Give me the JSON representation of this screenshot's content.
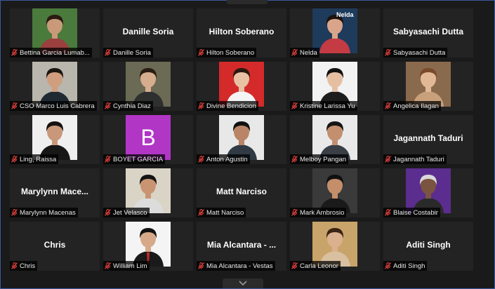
{
  "meeting": {
    "participants": [
      {
        "display": "Bettina Garcia Lumab...",
        "big_name": "",
        "has_video": true,
        "bg": "#4a7a3c",
        "skin": "#c99a7a",
        "hair": "#2a1a12",
        "shirt": "#9b3f3f"
      },
      {
        "display": "Danille Soria",
        "big_name": "Danille Soria",
        "has_video": false
      },
      {
        "display": "Hilton Soberano",
        "big_name": "Hilton Soberano",
        "has_video": false
      },
      {
        "display": "Nelda",
        "big_name": "",
        "has_video": true,
        "bg": "#1e3b5c",
        "skin": "#d9a58a",
        "hair": "#1c130d",
        "shirt": "#c43b44",
        "overlay_text": "Nelda"
      },
      {
        "display": "Sabyasachi Dutta",
        "big_name": "Sabyasachi Dutta",
        "has_video": false
      },
      {
        "display": "CSO Marco Luis Cabrera",
        "big_name": "",
        "has_video": true,
        "bg": "#b9b6ad",
        "skin": "#cf9e7e",
        "hair": "#1b1510",
        "shirt": "#1f2a33"
      },
      {
        "display": "Cynthia Diaz",
        "big_name": "",
        "has_video": true,
        "bg": "#6b6a55",
        "skin": "#d6ad8e",
        "hair": "#2a1e14",
        "shirt": "#2e2f2f"
      },
      {
        "display": "Divine Bendicion",
        "big_name": "",
        "has_video": true,
        "bg": "#d42a2a",
        "skin": "#e8c0a3",
        "hair": "#2a1a10",
        "shirt": "#f4f4f4"
      },
      {
        "display": "Kristine Larissa Yu",
        "big_name": "",
        "has_video": true,
        "bg": "#f2f2f2",
        "skin": "#e6bfa3",
        "hair": "#141010",
        "shirt": "#1d1d1d"
      },
      {
        "display": "Angelica Ilagan",
        "big_name": "",
        "has_video": true,
        "bg": "#8a6a4c",
        "skin": "#e2b996",
        "hair": "#7a4a2a",
        "shirt": "#c8a07c"
      },
      {
        "display": "Ling, Raissa",
        "big_name": "",
        "has_video": true,
        "bg": "#efefef",
        "skin": "#c9987a",
        "hair": "#161010",
        "shirt": "#171717"
      },
      {
        "display": "BOYET GARCIA",
        "big_name": "",
        "has_video": false,
        "avatar_letter": "B"
      },
      {
        "display": "Anton Agustin",
        "big_name": "",
        "has_video": true,
        "bg": "#e8e8e8",
        "skin": "#b98566",
        "hair": "#111",
        "shirt": "#303a44"
      },
      {
        "display": "Melboy Pangan",
        "big_name": "",
        "has_video": true,
        "bg": "#e9e9e9",
        "skin": "#c48f6f",
        "hair": "#151515",
        "shirt": "#3a3f47"
      },
      {
        "display": "Jagannath Taduri",
        "big_name": "Jagannath Taduri",
        "has_video": false
      },
      {
        "display": "Marylynn Macenas",
        "big_name": "Marylynn  Mace...",
        "has_video": false
      },
      {
        "display": "Jet Velasco",
        "big_name": "",
        "has_video": true,
        "bg": "#d9d4c6",
        "skin": "#c99472",
        "hair": "#141414",
        "shirt": "#dcdcdc"
      },
      {
        "display": "Matt Narciso",
        "big_name": "Matt Narciso",
        "has_video": false
      },
      {
        "display": "Mark Ambrosio",
        "big_name": "",
        "has_video": true,
        "bg": "#3a3a3a",
        "skin": "#c48e6b",
        "hair": "#101010",
        "shirt": "#1a1a1a"
      },
      {
        "display": "Blaise Costabir",
        "big_name": "",
        "has_video": true,
        "bg": "#5b2d8e",
        "skin": "#7a5440",
        "hair": "#d8d8d8",
        "shirt": "#2a2a2a"
      },
      {
        "display": "Chris",
        "big_name": "Chris",
        "has_video": false
      },
      {
        "display": "William Lim",
        "big_name": "",
        "has_video": true,
        "bg": "#f4f4f4",
        "skin": "#d6a988",
        "hair": "#121212",
        "shirt": "#1a1a1a",
        "tie": "#c22a2a"
      },
      {
        "display": "Mia Alcantara - Vestas",
        "big_name": "Mia  Alcantara  - ...",
        "has_video": false
      },
      {
        "display": "Carla Leonor",
        "big_name": "",
        "has_video": true,
        "bg": "#c9a46a",
        "skin": "#dbb08e",
        "hair": "#3a2414",
        "shirt": "#d8c0a0"
      },
      {
        "display": "Aditi Singh",
        "big_name": "Aditi Singh",
        "has_video": false
      }
    ]
  },
  "colors": {
    "tile_bg": "#232323",
    "mute_icon": "#e0413c",
    "avatar_bg": "#b136c6"
  }
}
